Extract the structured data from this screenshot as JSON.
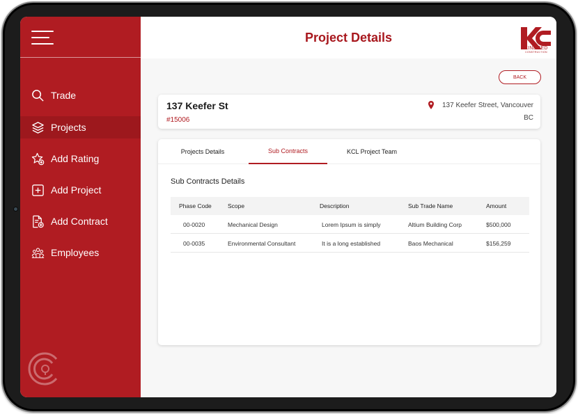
{
  "sidebar": {
    "items": [
      {
        "label": "Trade",
        "icon": "search-icon"
      },
      {
        "label": "Projects",
        "icon": "layers-icon",
        "active": true
      },
      {
        "label": "Add Rating",
        "icon": "star-add-icon"
      },
      {
        "label": "Add Project",
        "icon": "plus-square-icon"
      },
      {
        "label": "Add Contract",
        "icon": "document-add-icon"
      },
      {
        "label": "Employees",
        "icon": "team-icon"
      }
    ]
  },
  "header": {
    "title": "Project Details",
    "logo_text": "KINDRED",
    "logo_subtext": "CONSTRUCTION"
  },
  "back_label": "BACK",
  "project": {
    "name": "137 Keefer St",
    "id": "#15006",
    "address": "137 Keefer Street, Vancouver",
    "province": "BC"
  },
  "tabs": [
    {
      "label": "Projects Details",
      "active": false
    },
    {
      "label": "Sub Contracts",
      "active": true
    },
    {
      "label": "KCL Project Team",
      "active": false
    }
  ],
  "section_title": "Sub Contracts Details",
  "table": {
    "headers": [
      "Phase Code",
      "Scope",
      "Description",
      "Sub Trade Name",
      "Amount"
    ],
    "rows": [
      [
        "00-0020",
        "Mechanical Design",
        "Lorem Ipsum is simply",
        "Altium Building Corp",
        "$500,000"
      ],
      [
        "00-0035",
        "Environmental Consultant",
        "It is a long established",
        "Baos Mechanical",
        "$156,259"
      ]
    ]
  },
  "colors": {
    "brand": "#b01c22",
    "sidebar_active": "#9d181d"
  }
}
